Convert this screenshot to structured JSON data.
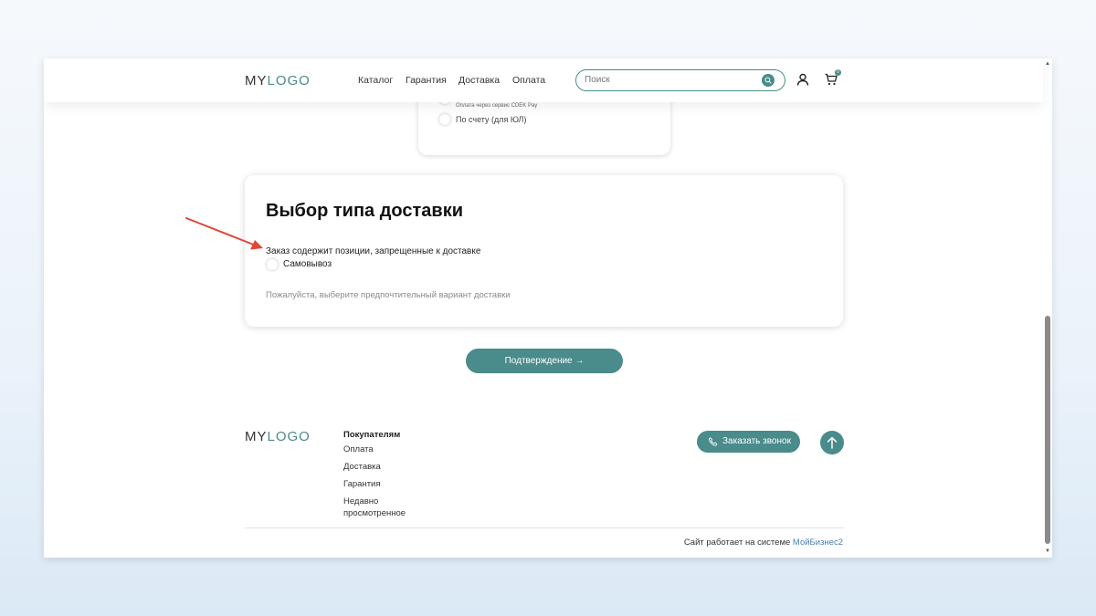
{
  "header": {
    "logo_my": "MY",
    "logo_logo": "LOGO",
    "nav": [
      "Каталог",
      "Гарантия",
      "Доставка",
      "Оплата"
    ],
    "search_placeholder": "Поиск",
    "cart_count": "0"
  },
  "payment": {
    "cdek_note": "Оплата через сервис CDEK Pay",
    "invoice_label": "По счету (для ЮЛ)"
  },
  "delivery": {
    "title": "Выбор типа доставки",
    "warning": "Заказ содержит позиции, запрещенные к доставке",
    "pickup_label": "Самовывоз",
    "hint": "Пожалуйста, выберите предпочтительный вариант доставки"
  },
  "confirm_label": "Подтверждение →",
  "footer": {
    "logo_my": "MY",
    "logo_logo": "LOGO",
    "heading": "Покупателям",
    "links": [
      "Оплата",
      "Доставка",
      "Гарантия",
      "Недавно просмотренное"
    ],
    "call_label": "Заказать звонок",
    "credit_text": "Сайт работает на системе ",
    "credit_brand": "МойБизнес2"
  },
  "colors": {
    "accent": "#4a8b8b",
    "annotation": "#e0463a",
    "link": "#4a7fb0"
  }
}
